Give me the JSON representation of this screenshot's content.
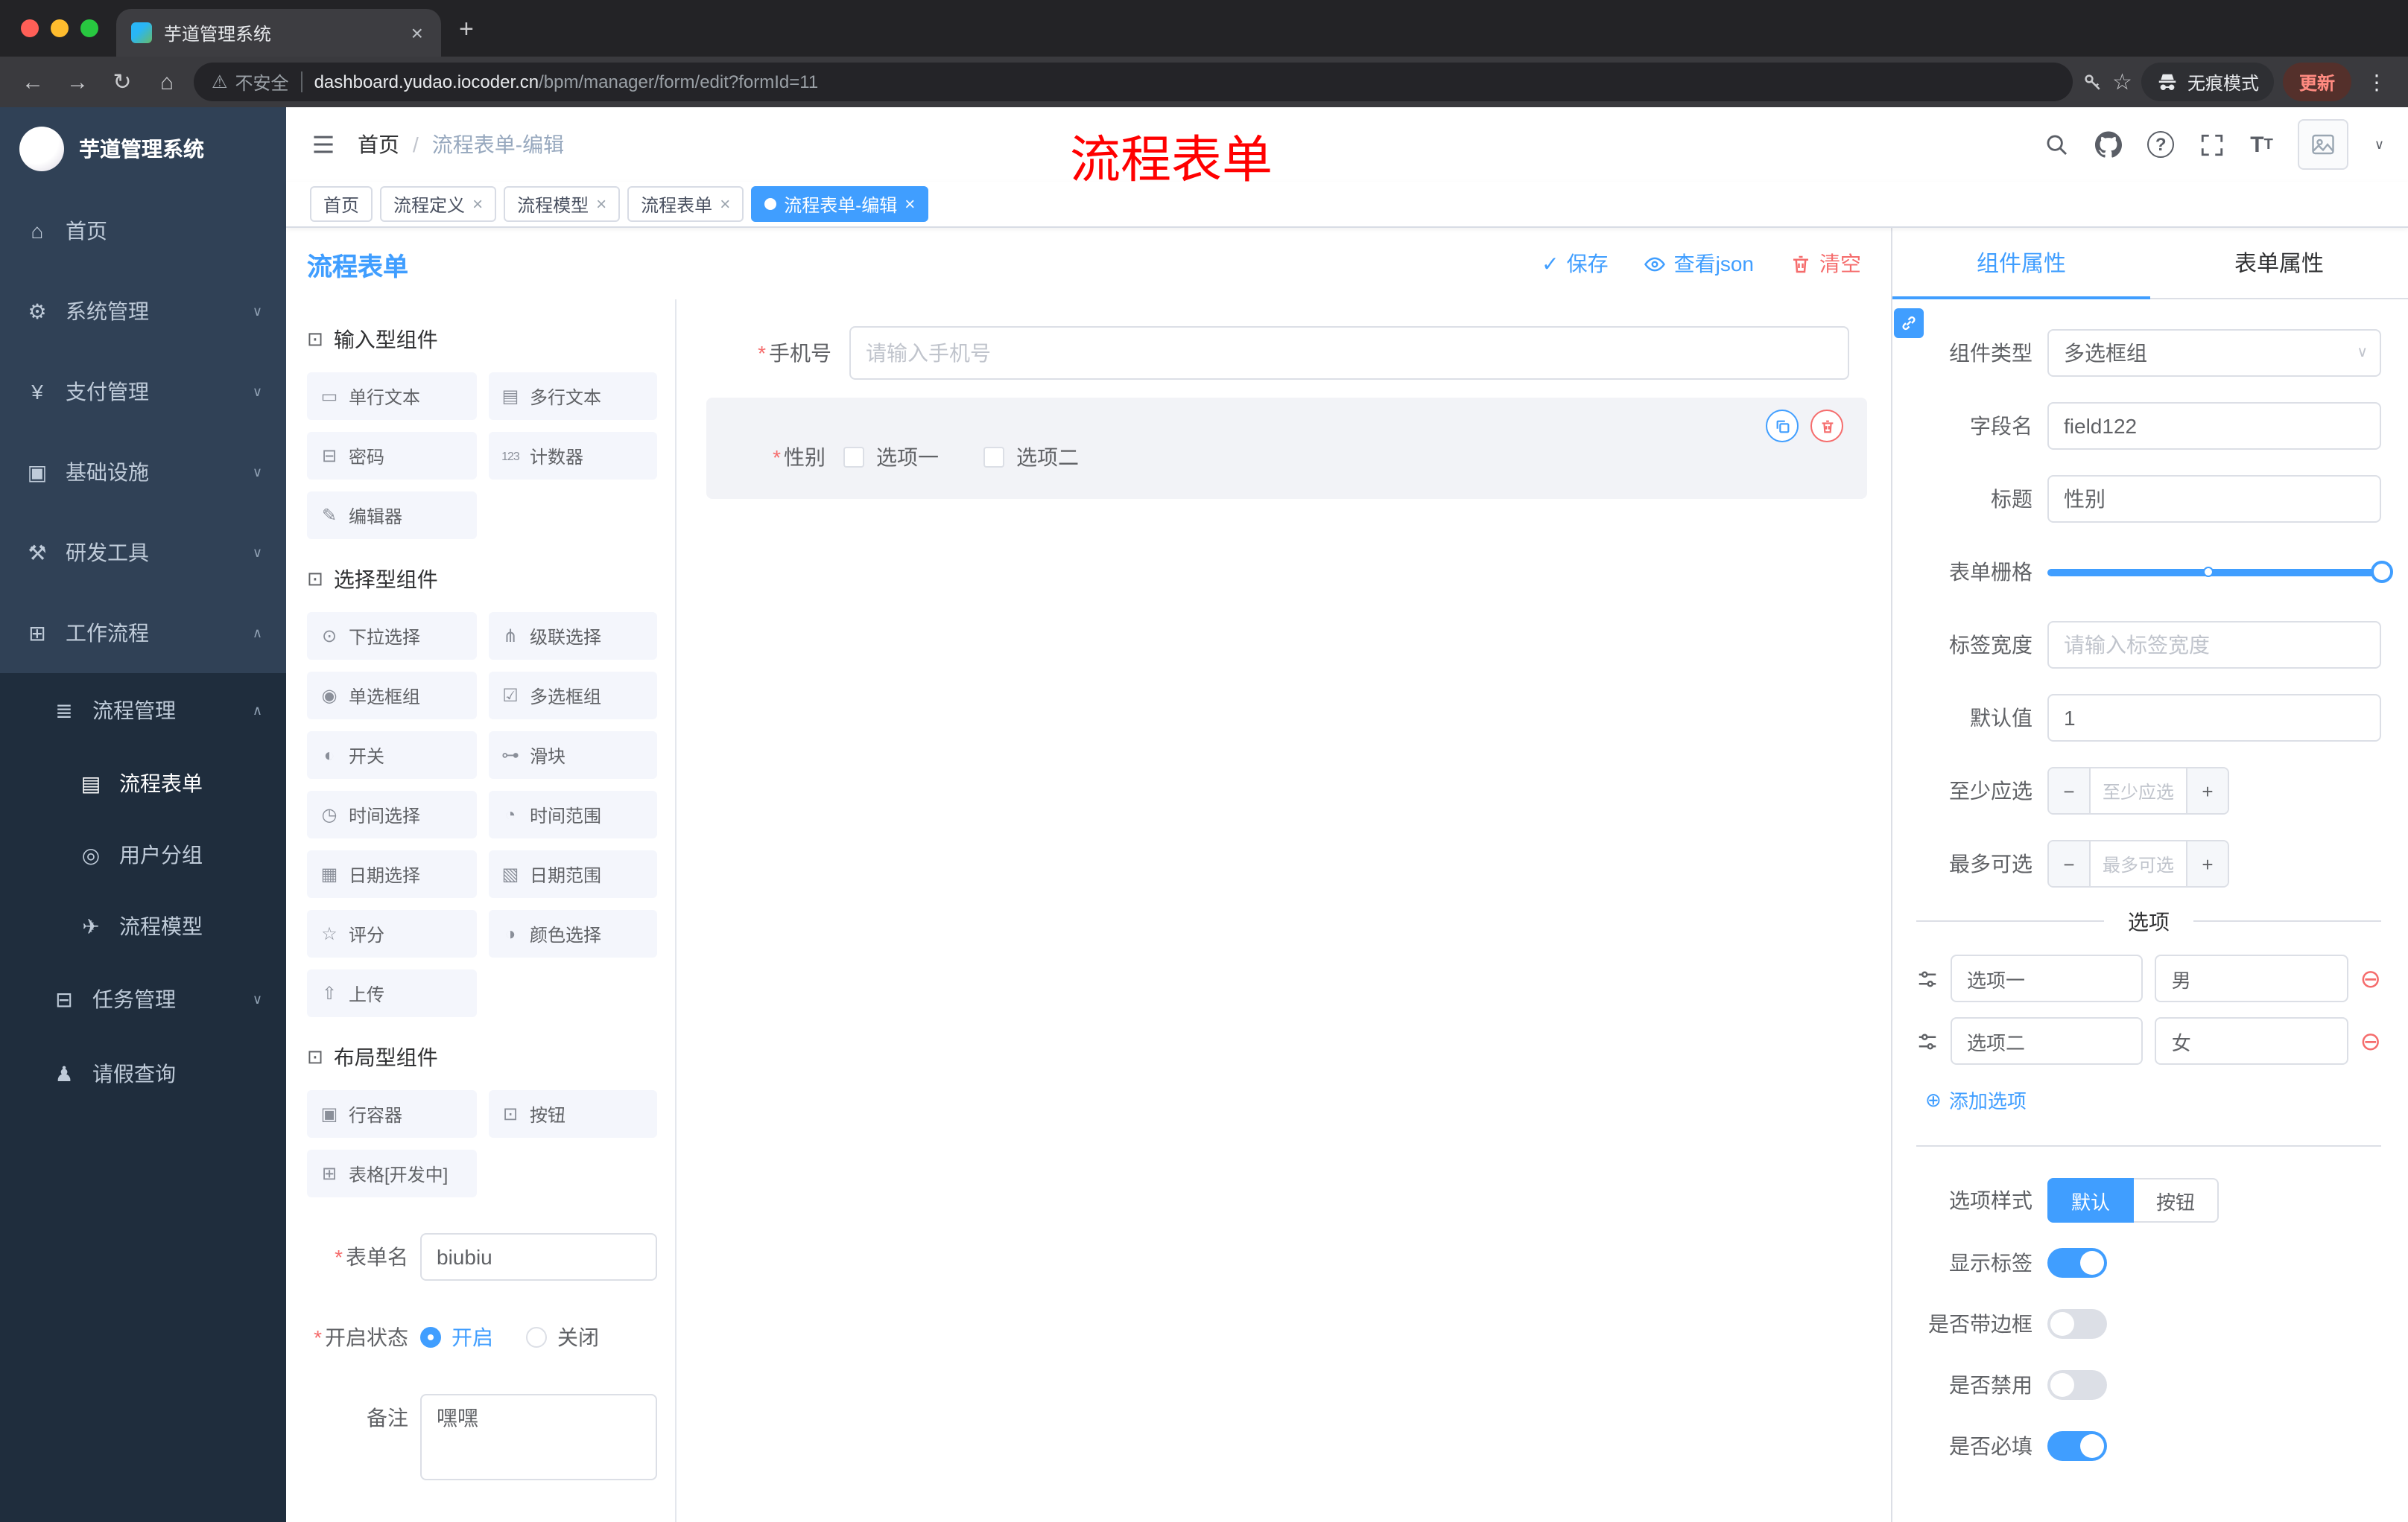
{
  "browser": {
    "tab_title": "芋道管理系统",
    "new_tab_icon": "+",
    "close_icon": "×",
    "nav": {
      "back": "←",
      "forward": "→",
      "reload": "↻",
      "home": "⌂"
    },
    "warning_icon": "⚠",
    "not_secure": "不安全",
    "url_domain": "dashboard.yudao.iocoder.cn",
    "url_path": "/bpm/manager/form/edit?formId=11",
    "star_icon": "☆",
    "incognito": "无痕模式",
    "update": "更新",
    "menu_icon": "⋮"
  },
  "sidebar": {
    "logo": "芋道管理系统",
    "top_items": [
      {
        "label": "首页",
        "icon": "⌂"
      },
      {
        "label": "系统管理",
        "icon": "⚙",
        "chevron": "∨"
      },
      {
        "label": "支付管理",
        "icon": "¥",
        "chevron": "∨"
      },
      {
        "label": "基础设施",
        "icon": "▣",
        "chevron": "∨"
      },
      {
        "label": "研发工具",
        "icon": "⚒",
        "chevron": "∨"
      },
      {
        "label": "工作流程",
        "icon": "⊞",
        "chevron": "∧"
      }
    ],
    "group": {
      "label": "流程管理",
      "icon": "≣",
      "chevron": "∧"
    },
    "children": [
      {
        "label": "流程表单",
        "icon": "▤",
        "active": true
      },
      {
        "label": "用户分组",
        "icon": "◎"
      },
      {
        "label": "流程模型",
        "icon": "✈"
      }
    ],
    "tail_items": [
      {
        "label": "任务管理",
        "icon": "⊟",
        "chevron": "∨"
      },
      {
        "label": "请假查询",
        "icon": "♟"
      }
    ]
  },
  "header": {
    "breadcrumb_home": "首页",
    "breadcrumb_sep": "/",
    "breadcrumb_current": "流程表单-编辑",
    "watermark": "流程表单",
    "caret": "∨"
  },
  "tags": [
    {
      "label": "首页"
    },
    {
      "label": "流程定义",
      "close": "×"
    },
    {
      "label": "流程模型",
      "close": "×"
    },
    {
      "label": "流程表单",
      "close": "×"
    },
    {
      "label": "流程表单-编辑",
      "close": "×",
      "active": true
    }
  ],
  "designer": {
    "title": "流程表单",
    "actions": {
      "save_icon": "✓",
      "save": "保存",
      "view_json": "查看json",
      "clear": "清空"
    },
    "palette": {
      "sections": [
        {
          "title": "输入型组件",
          "icon": "⊡",
          "items": [
            {
              "label": "单行文本",
              "icon": "▭"
            },
            {
              "label": "多行文本",
              "icon": "▤"
            },
            {
              "label": "密码",
              "icon": "⊟"
            },
            {
              "label": "计数器",
              "icon": "123"
            },
            {
              "label": "编辑器",
              "icon": "✎"
            }
          ]
        },
        {
          "title": "选择型组件",
          "icon": "⊡",
          "items": [
            {
              "label": "下拉选择",
              "icon": "⊙"
            },
            {
              "label": "级联选择",
              "icon": "⋔"
            },
            {
              "label": "单选框组",
              "icon": "◉"
            },
            {
              "label": "多选框组",
              "icon": "☑"
            },
            {
              "label": "开关",
              "icon": "◐"
            },
            {
              "label": "滑块",
              "icon": "⊶"
            },
            {
              "label": "时间选择",
              "icon": "◷"
            },
            {
              "label": "时间范围",
              "icon": "◔"
            },
            {
              "label": "日期选择",
              "icon": "▦"
            },
            {
              "label": "日期范围",
              "icon": "▧"
            },
            {
              "label": "评分",
              "icon": "☆"
            },
            {
              "label": "颜色选择",
              "icon": "◑"
            },
            {
              "label": "上传",
              "icon": "⇧"
            }
          ]
        },
        {
          "title": "布局型组件",
          "icon": "⊡",
          "items": [
            {
              "label": "行容器",
              "icon": "▣"
            },
            {
              "label": "按钮",
              "icon": "⊡"
            },
            {
              "label": "表格[开发中]",
              "icon": "⊞"
            }
          ]
        }
      ],
      "form": {
        "name_label": "表单名",
        "name_value": "biubiu",
        "status_label": "开启状态",
        "status_on": "开启",
        "status_off": "关闭",
        "remark_label": "备注",
        "remark_value": "嘿嘿"
      }
    },
    "canvas": {
      "phone_label": "手机号",
      "phone_placeholder": "请输入手机号",
      "gender_label": "性别",
      "gender_options": [
        "选项一",
        "选项二"
      ]
    },
    "props": {
      "tab_component": "组件属性",
      "tab_form": "表单属性",
      "caret": "∨",
      "component_type_label": "组件类型",
      "component_type_value": "多选框组",
      "field_label": "字段名",
      "field_value": "field122",
      "title_label": "标题",
      "title_value": "性别",
      "grid_label": "表单栅格",
      "label_width_label": "标签宽度",
      "label_width_placeholder": "请输入标签宽度",
      "default_label": "默认值",
      "default_value": "1",
      "min_label": "至少应选",
      "min_placeholder": "至少应选",
      "max_label": "最多可选",
      "max_placeholder": "最多可选",
      "stepper_minus": "−",
      "stepper_plus": "+",
      "options_divider": "选项",
      "options": [
        {
          "label": "选项一",
          "value": "男"
        },
        {
          "label": "选项二",
          "value": "女"
        }
      ],
      "remove_icon": "⊖",
      "add_icon": "⊕",
      "add_option": "添加选项",
      "style_label": "选项样式",
      "style_options": [
        "默认",
        "按钮"
      ],
      "switch_rows": [
        {
          "label": "显示标签",
          "on": true
        },
        {
          "label": "是否带边框",
          "on": false
        },
        {
          "label": "是否禁用",
          "on": false
        },
        {
          "label": "是否必填",
          "on": true
        }
      ]
    }
  },
  "colors": {
    "accent": "#409eff",
    "danger": "#f56c6c",
    "watermark": "#ff0000",
    "sidebar": "#304156",
    "sidebar_sub": "#1f2d3d"
  }
}
